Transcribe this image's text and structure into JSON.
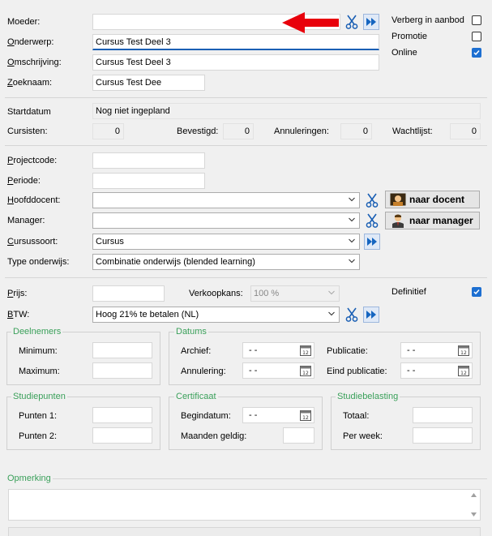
{
  "labels": {
    "moeder": "Moeder:",
    "onderwerp_u": "O",
    "onderwerp_rest": "nderwerp:",
    "omschrijving_u": "O",
    "omschrijving_rest": "mschrijving:",
    "zoeknaam_u": "Z",
    "zoeknaam_rest": "oeknaam:",
    "startdatum": "Startdatum",
    "cursisten": "Cursisten:",
    "bevestigd": "Bevestigd:",
    "annuleringen": "Annuleringen:",
    "wachtlijst": "Wachtlijst:",
    "projectcode_u": "P",
    "projectcode_rest": "rojectcode:",
    "periode_u": "P",
    "periode_rest": "eriode:",
    "hoofddocent_u": "H",
    "hoofddocent_rest": "oofddocent:",
    "manager": "Manager:",
    "cursussoort_u": "C",
    "cursussoort_rest": "ursussoort:",
    "type_onderwijs": "Type onderwijs:",
    "prijs_u": "P",
    "prijs_rest": "rijs:",
    "verkoopkans": "Verkoopkans:",
    "definitief": "Definitief",
    "btw_u": "B",
    "btw_rest": "TW:"
  },
  "fields": {
    "moeder": "",
    "onderwerp": "Cursus Test Deel 3",
    "omschrijving": "Cursus Test Deel 3",
    "zoeknaam": "Cursus Test Dee",
    "startdatum": "Nog niet ingepland",
    "cursisten": "0",
    "bevestigd": "0",
    "annuleringen": "0",
    "wachtlijst": "0",
    "projectcode": "",
    "periode": "",
    "hoofddocent": "",
    "manager": "",
    "cursussoort": "Cursus",
    "type_onderwijs": "Combinatie onderwijs (blended learning)",
    "prijs": "",
    "verkoopkans": "100 %",
    "btw": "Hoog 21% te betalen (NL)"
  },
  "checks": {
    "verberg_label": "Verberg in aanbod",
    "verberg": false,
    "promotie_label": "Promotie",
    "promotie": false,
    "online_label": "Online",
    "online": true,
    "definitief": true
  },
  "buttons": {
    "naar_docent": "naar docent",
    "naar_manager": "naar manager"
  },
  "groups": {
    "deelnemers": {
      "title": "Deelnemers",
      "minimum": "Minimum:",
      "maximum": "Maximum:"
    },
    "datums": {
      "title": "Datums",
      "archief": "Archief:",
      "annulering": "Annulering:",
      "publicatie": "Publicatie:",
      "eind_publicatie": "Eind publicatie:",
      "empty_date": "-  -"
    },
    "studiepunten": {
      "title": "Studiepunten",
      "punten1": "Punten 1:",
      "punten2": "Punten 2:"
    },
    "certificaat": {
      "title": "Certificaat",
      "begindatum": "Begindatum:",
      "maanden": "Maanden geldig:"
    },
    "studiebelasting": {
      "title": "Studiebelasting",
      "totaal": "Totaal:",
      "per_week": "Per week:"
    }
  },
  "opmerking": {
    "title": "Opmerking",
    "value": ""
  },
  "colors": {
    "accent": "#1d6fd1",
    "group_title": "#3aa05a",
    "arrow": "#e8000b"
  }
}
